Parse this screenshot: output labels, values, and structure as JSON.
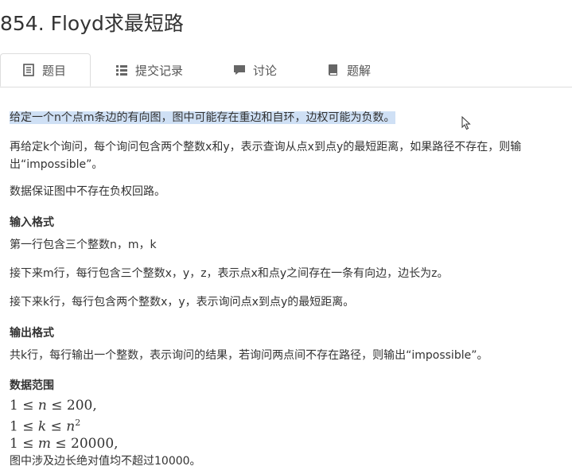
{
  "problem": {
    "title": "854. Floyd求最短路"
  },
  "tabs": [
    {
      "label": "题目",
      "icon": "document-icon"
    },
    {
      "label": "提交记录",
      "icon": "list-icon"
    },
    {
      "label": "讨论",
      "icon": "chat-bubble-icon"
    },
    {
      "label": "题解",
      "icon": "book-icon"
    }
  ],
  "description": {
    "p1": "给定一个n个点m条边的有向图，图中可能存在重边和自环，边权可能为负数。",
    "p2_line1": "再给定k个询问，每个询问包含两个整数x和y，表示查询从点x到点y的最短距离，如果路径不存在，则输",
    "p2_line2": "出“impossible”。",
    "p3": "数据保证图中不存在负权回路。"
  },
  "input_format": {
    "heading": "输入格式",
    "line1": "第一行包含三个整数n，m，k",
    "line2": "接下来m行，每行包含三个整数x，y，z，表示点x和点y之间存在一条有向边，边长为z。",
    "line3": "接下来k行，每行包含两个整数x，y，表示询问点x到点y的最短距离。"
  },
  "output_format": {
    "heading": "输出格式",
    "line1": "共k行，每行输出一个整数，表示询问的结果，若询问两点间不存在路径，则输出“impossible”。"
  },
  "data_range": {
    "heading": "数据范围",
    "c1_prefix": "1 ≤ ",
    "c1_var": "n",
    "c1_suffix": " ≤ 200,",
    "c2_prefix": "1 ≤ ",
    "c2_var": "k",
    "c2_mid": " ≤ ",
    "c2_var2": "n",
    "c2_exp": "2",
    "c3_prefix": "1 ≤ ",
    "c3_var": "m",
    "c3_suffix": " ≤ 20000,",
    "note": "图中涉及边长绝对值均不超过10000。"
  }
}
